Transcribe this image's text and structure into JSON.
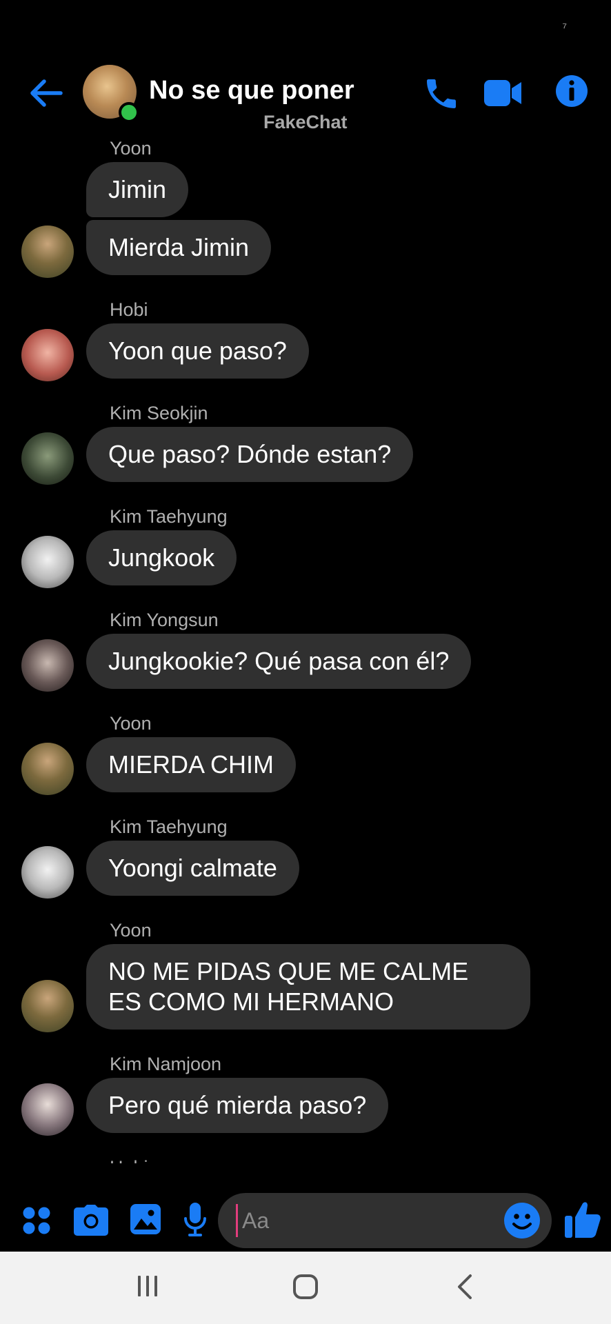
{
  "status_bar": {
    "glyph": "⁷"
  },
  "header": {
    "title": "No se que poner",
    "subtitle": "FakeChat",
    "accent": "#1a7cf5",
    "icons": [
      "back-arrow-icon",
      "phone-icon",
      "video-camera-icon",
      "info-icon"
    ]
  },
  "messages": [
    {
      "sender": "Yoon",
      "avatar": "yoon",
      "bubbles": [
        "Jimin",
        "Mierda Jimin"
      ]
    },
    {
      "sender": "Hobi",
      "avatar": "hobi",
      "bubbles": [
        "Yoon que paso?"
      ]
    },
    {
      "sender": "Kim Seokjin",
      "avatar": "seokjin",
      "bubbles": [
        "Que paso? Dónde estan?"
      ]
    },
    {
      "sender": "Kim Taehyung",
      "avatar": "taehyung",
      "bubbles": [
        "Jungkook"
      ]
    },
    {
      "sender": "Kim Yongsun",
      "avatar": "yongsun",
      "bubbles": [
        "Jungkookie? Qué pasa con él?"
      ]
    },
    {
      "sender": "Yoon",
      "avatar": "yoon",
      "bubbles": [
        "MIERDA CHIM"
      ]
    },
    {
      "sender": "Kim Taehyung",
      "avatar": "taehyung",
      "bubbles": [
        "Yoongi calmate"
      ]
    },
    {
      "sender": "Yoon",
      "avatar": "yoon",
      "bubbles": [
        "NO ME PIDAS QUE ME CALME ES COMO MI HERMANO"
      ]
    },
    {
      "sender": "Kim Namjoon",
      "avatar": "namjoon",
      "bubbles": [
        "Pero qué mierda paso?"
      ]
    }
  ],
  "partial_sender": "Hobi",
  "composer": {
    "placeholder": "Aa",
    "icons": [
      "apps-grid-icon",
      "camera-icon",
      "image-icon",
      "microphone-icon",
      "emoji-icon",
      "thumbs-up-icon"
    ]
  },
  "navbar": {
    "icons": [
      "recent-apps-icon",
      "home-icon",
      "back-icon"
    ]
  }
}
